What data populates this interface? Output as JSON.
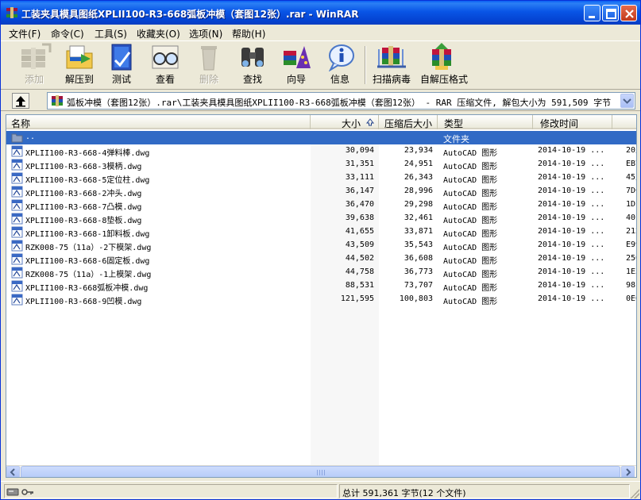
{
  "window": {
    "title": "工装夹具模具图纸XPLII100-R3-668弧板冲模（套图12张）.rar - WinRAR"
  },
  "menu": [
    "文件(F)",
    "命令(C)",
    "工具(S)",
    "收藏夹(O)",
    "选项(N)",
    "帮助(H)"
  ],
  "toolbar": {
    "add": "添加",
    "extract": "解压到",
    "test": "测试",
    "view": "查看",
    "delete": "删除",
    "find": "查找",
    "wizard": "向导",
    "info": "信息",
    "scan": "扫描病毒",
    "sfx": "自解压格式"
  },
  "address": {
    "path": "弧板冲模（套图12张）.rar\\工装夹具模具图纸XPLII100-R3-668弧板冲模（套图12张） - RAR 压缩文件, 解包大小为 591,509 字节"
  },
  "columns": {
    "name": "名称",
    "size": "大小",
    "packed": "压缩后大小",
    "type": "类型",
    "modified": "修改时间"
  },
  "parent_row": {
    "name": "..",
    "type": "文件夹"
  },
  "files": [
    {
      "name": "XPLII100-R3-668-4弹料棒.dwg",
      "size": "30,094",
      "packed": "23,934",
      "type": "AutoCAD 图形",
      "modified": "2014-10-19 ...",
      "crc": "20/"
    },
    {
      "name": "XPLII100-R3-668-3模柄.dwg",
      "size": "31,351",
      "packed": "24,951",
      "type": "AutoCAD 图形",
      "modified": "2014-10-19 ...",
      "crc": "EB7"
    },
    {
      "name": "XPLII100-R3-668-5定位柱.dwg",
      "size": "33,111",
      "packed": "26,343",
      "type": "AutoCAD 图形",
      "modified": "2014-10-19 ...",
      "crc": "45/"
    },
    {
      "name": "XPLII100-R3-668-2冲头.dwg",
      "size": "36,147",
      "packed": "28,996",
      "type": "AutoCAD 图形",
      "modified": "2014-10-19 ...",
      "crc": "7DC"
    },
    {
      "name": "XPLII100-R3-668-7凸模.dwg",
      "size": "36,470",
      "packed": "29,298",
      "type": "AutoCAD 图形",
      "modified": "2014-10-19 ...",
      "crc": "1DE"
    },
    {
      "name": "XPLII100-R3-668-8垫板.dwg",
      "size": "39,638",
      "packed": "32,461",
      "type": "AutoCAD 图形",
      "modified": "2014-10-19 ...",
      "crc": "40E"
    },
    {
      "name": "XPLII100-R3-668-1卸料板.dwg",
      "size": "41,655",
      "packed": "33,871",
      "type": "AutoCAD 图形",
      "modified": "2014-10-19 ...",
      "crc": "212"
    },
    {
      "name": "RZK008-75（11a）-2下模架.dwg",
      "size": "43,509",
      "packed": "35,543",
      "type": "AutoCAD 图形",
      "modified": "2014-10-19 ...",
      "crc": "E99"
    },
    {
      "name": "XPLII100-R3-668-6固定板.dwg",
      "size": "44,502",
      "packed": "36,608",
      "type": "AutoCAD 图形",
      "modified": "2014-10-19 ...",
      "crc": "250"
    },
    {
      "name": "RZK008-75（11a）-1上模架.dwg",
      "size": "44,758",
      "packed": "36,773",
      "type": "AutoCAD 图形",
      "modified": "2014-10-19 ...",
      "crc": "1E3"
    },
    {
      "name": "XPLII100-R3-668弧板冲模.dwg",
      "size": "88,531",
      "packed": "73,707",
      "type": "AutoCAD 图形",
      "modified": "2014-10-19 ...",
      "crc": "98E"
    },
    {
      "name": "XPLII100-R3-668-9凹模.dwg",
      "size": "121,595",
      "packed": "100,803",
      "type": "AutoCAD 图形",
      "modified": "2014-10-19 ...",
      "crc": "0E0"
    }
  ],
  "status": {
    "total": "总计 591,361 字节(12 个文件)"
  },
  "icons": {
    "app": "winrar-books-icon",
    "file": "autocad-dwg-icon",
    "folder": "folder-up-icon"
  },
  "colors": {
    "titlebar": "#0a5ef3",
    "selection": "#316ac5",
    "face": "#ece9d8"
  }
}
